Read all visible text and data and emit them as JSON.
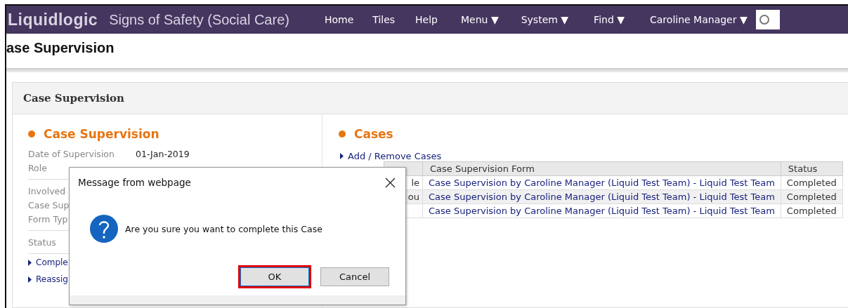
{
  "app": {
    "logo": "Liquidlogic",
    "title": "Signs of Safety (Social Care)"
  },
  "nav": [
    {
      "label": "Home",
      "dropdown": false
    },
    {
      "label": "Tiles",
      "dropdown": false
    },
    {
      "label": "Help",
      "dropdown": false
    },
    {
      "label": "Menu",
      "dropdown": true
    },
    {
      "label": "System",
      "dropdown": true
    },
    {
      "label": "Find",
      "dropdown": true
    },
    {
      "label": "Caroline Manager",
      "dropdown": true
    }
  ],
  "caret": "▼",
  "page_title": "ase Supervision",
  "panel": {
    "title": "Case Supervision",
    "details": {
      "heading": "Case Supervision",
      "groups": [
        [
          {
            "label": "Date of Supervision",
            "value": "01-Jan-2019"
          },
          {
            "label": "Role"
          }
        ],
        [
          {
            "label": "Involved"
          },
          {
            "label": "Case Sup"
          },
          {
            "label": "Form Typ"
          }
        ],
        [
          {
            "label": "Status"
          }
        ]
      ],
      "links": [
        "Comple",
        "Reassig"
      ]
    },
    "cases": {
      "heading": "Cases",
      "link": "Add / Remove Cases",
      "columns": [
        "",
        "Case Supervision Form",
        "Status"
      ],
      "rows": [
        [
          "le",
          "Case Supervision by Caroline Manager (Liquid Test Team) - Liquid Test Team",
          "Completed"
        ],
        [
          "ou",
          "Case Supervision by Caroline Manager (Liquid Test Team) - Liquid Test Team",
          "Completed"
        ],
        [
          "",
          "Case Supervision by Caroline Manager (Liquid Test Team) - Liquid Test Team",
          "Completed"
        ]
      ]
    }
  },
  "dialog": {
    "title": "Message from webpage",
    "message": "Are you sure you want to complete this Case",
    "buttons": [
      {
        "label": "OK",
        "highlighted": true
      },
      {
        "label": "Cancel",
        "highlighted": false
      }
    ]
  }
}
